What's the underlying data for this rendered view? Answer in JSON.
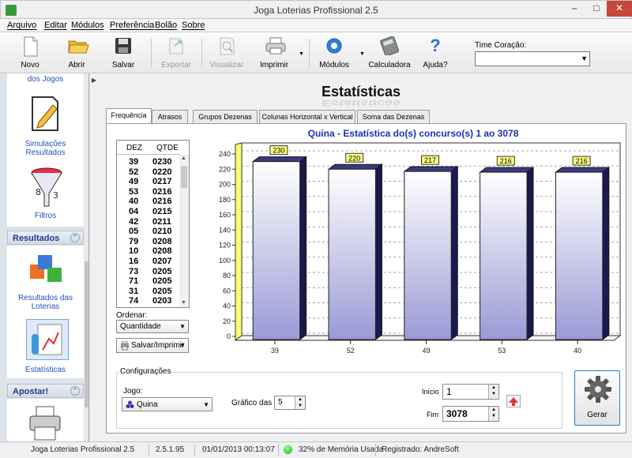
{
  "window": {
    "title": "Joga Loterias Profissional 2.5",
    "min": "–",
    "max": "□",
    "close": "✕"
  },
  "menu": [
    "Arquivo",
    "Editar",
    "Módulos",
    "Preferência",
    "Bolão",
    "Sobre"
  ],
  "toolbar": {
    "novo": "Novo",
    "abrir": "Abrir",
    "salvar": "Salvar",
    "exportar": "Exportar",
    "visualizar": "Visualizar",
    "imprimir": "Imprimir",
    "modulos": "Módulos",
    "calculadora": "Calculadora",
    "ajuda": "Ajuda?"
  },
  "time_coracao": {
    "label": "Time Coração:",
    "value": ""
  },
  "sidebar": {
    "dos_jogos": "dos Jogos",
    "simulacoes": "Simulações Resultados",
    "filtros": "Filtros",
    "resultados_head": "Resultados",
    "resultados_loterias": "Resultados das Loterias",
    "estatisticas": "Estatísticas",
    "apostar_head": "Apostar!"
  },
  "page": {
    "title": "Estatísticas"
  },
  "tabs": [
    "Frequência",
    "Atrasos",
    "Grupos Dezenas",
    "Colunas Horizontal x Vertical",
    "Soma das Dezenas"
  ],
  "list": {
    "col_dez": "DEZ",
    "col_qtde": "QTDE",
    "rows": [
      [
        "39",
        "0230"
      ],
      [
        "52",
        "0220"
      ],
      [
        "49",
        "0217"
      ],
      [
        "53",
        "0216"
      ],
      [
        "40",
        "0216"
      ],
      [
        "04",
        "0215"
      ],
      [
        "42",
        "0211"
      ],
      [
        "05",
        "0210"
      ],
      [
        "79",
        "0208"
      ],
      [
        "10",
        "0208"
      ],
      [
        "16",
        "0207"
      ],
      [
        "73",
        "0205"
      ],
      [
        "71",
        "0205"
      ],
      [
        "31",
        "0205"
      ],
      [
        "74",
        "0203"
      ]
    ]
  },
  "ordenar": {
    "label": "Ordenar:",
    "value": "Quantidade"
  },
  "salvar_imprimir": "Salvar/Imprimir",
  "chart_data": {
    "type": "bar",
    "title": "Quina - Estatística do(s) concurso(s) 1 ao 3078",
    "categories": [
      "39",
      "52",
      "49",
      "53",
      "40"
    ],
    "values": [
      230,
      220,
      217,
      216,
      216
    ],
    "data_labels": [
      "230",
      "220",
      "217",
      "216",
      "216"
    ],
    "ylim": [
      0,
      240
    ],
    "yticks": [
      "0",
      "20",
      "40",
      "60",
      "80",
      "100",
      "120",
      "140",
      "160",
      "180",
      "200",
      "220",
      "240"
    ],
    "grid": true,
    "bar_color": "#9a9ad6",
    "label_bg": "#ffff80"
  },
  "config": {
    "legend": "Configurações",
    "jogo_label": "Jogo:",
    "jogo_value": "Quina",
    "grafico_label": "Gráfico das",
    "grafico_value": "5",
    "inicio_label": "Início",
    "inicio_value": "1",
    "fim_label": "Fim",
    "fim_value": "3078",
    "gerar": "Gerar"
  },
  "status": {
    "app": "Joga Loterias Profissional 2.5",
    "version": "2.5.1.95",
    "datetime": "01/01/2013 00:13:07",
    "memory": "32% de Memória Usada",
    "registered": "Registrado: AndreSoft"
  }
}
